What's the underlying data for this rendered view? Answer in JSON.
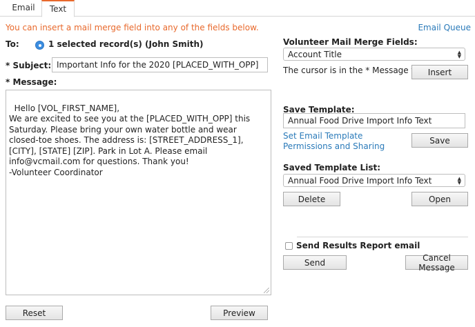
{
  "tabs": [
    {
      "label": "Email",
      "active": false
    },
    {
      "label": "Text",
      "active": true
    }
  ],
  "notice": "You can insert a mail merge field into any of the fields below.",
  "email_queue_link": "Email Queue",
  "to": {
    "label": "To:",
    "recipient": "1 selected record(s) (John Smith)"
  },
  "subject": {
    "label": "* Subject:",
    "value": "Important Info for the 2020 [PLACED_WITH_OPP]"
  },
  "message": {
    "label": "* Message:",
    "value": "Hello [VOL_FIRST_NAME],\nWe are excited to see you at the [PLACED_WITH_OPP] this Saturday. Please bring your own water bottle and wear closed-toe shoes. The address is: [STREET_ADDRESS_1], [CITY], [STATE] [ZIP]. Park in Lot A. Please email info@vcmail.com for questions. Thank you!\n-Volunteer Coordinator"
  },
  "buttons": {
    "reset": "Reset",
    "preview": "Preview",
    "insert": "Insert",
    "save": "Save",
    "delete": "Delete",
    "open": "Open",
    "send": "Send",
    "cancel": "Cancel Message"
  },
  "merge_fields": {
    "label": "Volunteer Mail Merge Fields:",
    "selected": "Account Title",
    "cursor_note": "The cursor is in the * Message field."
  },
  "save_template": {
    "label": "Save Template:",
    "value": "Annual Food Drive Import Info Text",
    "permissions_link": "Set Email Template Permissions and Sharing"
  },
  "saved_list": {
    "label": "Saved Template List:",
    "selected": "Annual Food Drive Import Info Text"
  },
  "send_report": {
    "label": "Send Results Report email",
    "checked": false
  },
  "colors": {
    "accent": "#e8692c",
    "link": "#2a7ab9",
    "radio": "#3b8de0"
  }
}
